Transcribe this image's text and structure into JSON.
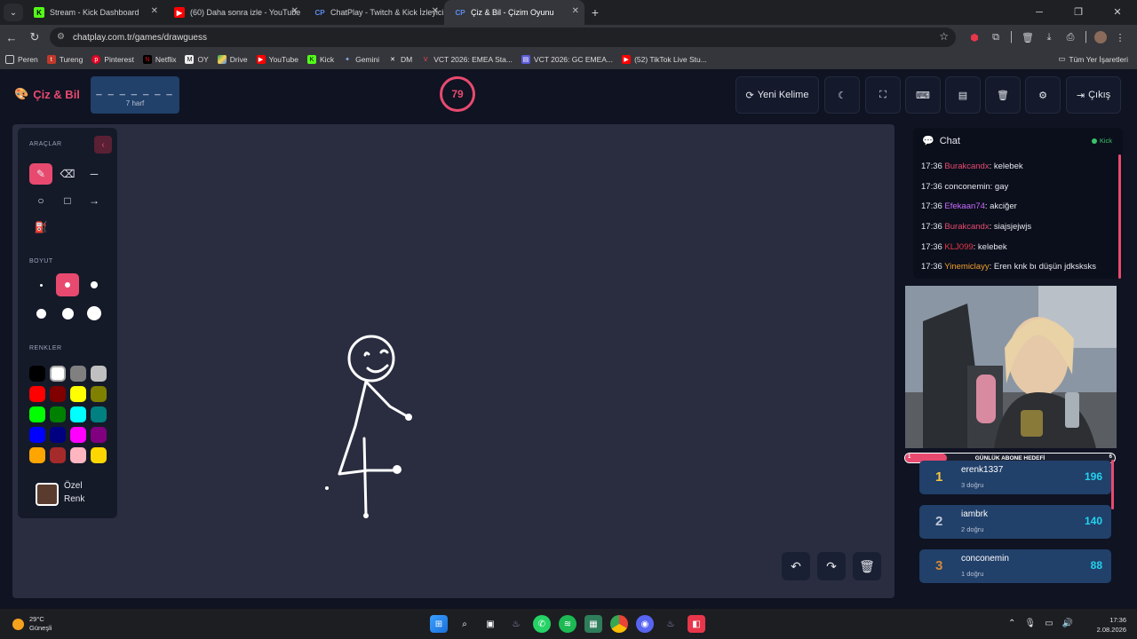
{
  "browser": {
    "tabs": [
      {
        "title": "Stream - Kick Dashboard",
        "favicon": "K",
        "color": "#53fc18"
      },
      {
        "title": "(60) Daha sonra izle - YouTube",
        "favicon": "▶",
        "color": "#ff0000"
      },
      {
        "title": "ChatPlay - Twitch & Kick İzleyici",
        "favicon": "CP",
        "color": "#5b8def"
      },
      {
        "title": "Çiz & Bil - Çizim Oyunu",
        "favicon": "CP",
        "color": "#5b8def"
      }
    ],
    "url": "chatplay.com.tr/games/drawguess",
    "bookmarks": [
      "Peren",
      "Tureng",
      "Pinterest",
      "Netflix",
      "OY",
      "Drive",
      "YouTube",
      "Kick",
      "Gemini",
      "DM",
      "VCT 2026: EMEA Sta...",
      "VCT 2026: GC EMEA...",
      "(52) TikTok Live Stu..."
    ],
    "all_bookmarks": "Tüm Yer İşaretleri"
  },
  "game": {
    "logo": "Çiz & Bil",
    "word_mask": "_ _ _ _ _ _ _",
    "word_length": "7 harf",
    "timer": "79",
    "timer_progress": 0.9,
    "buttons": {
      "new_word": "Yeni Kelime",
      "exit": "Çıkış"
    }
  },
  "tools": {
    "tools_title": "ARAÇLAR",
    "size_title": "BOYUT",
    "colors_title": "RENKLER",
    "custom_color_label": "Özel Renk",
    "selected_tool": "pencil",
    "selected_size": 2,
    "custom_color": "#5a3c2e",
    "palette": [
      "#000000",
      "#ffffff",
      "#808080",
      "#c0c0c0",
      "#ff0000",
      "#800000",
      "#ffff00",
      "#808000",
      "#00ff00",
      "#008000",
      "#00ffff",
      "#008080",
      "#0000ff",
      "#000080",
      "#ff00ff",
      "#800080",
      "#ffa500",
      "#a52a2a",
      "#ffb6c1",
      "#ffd700"
    ]
  },
  "chat": {
    "title": "Chat",
    "source": "Kick",
    "messages": [
      {
        "time": "17:36",
        "user": "Burakcandx",
        "color": "#e84a6f",
        "text": "kelebek"
      },
      {
        "time": "17:36",
        "user": "conconemin",
        "color": "#e6e8ef",
        "text": "gay"
      },
      {
        "time": "17:36",
        "user": "Efekaan74",
        "color": "#c86bff",
        "text": "akciğer"
      },
      {
        "time": "17:36",
        "user": "Burakcandx",
        "color": "#e84a6f",
        "text": "siajsjejwjs"
      },
      {
        "time": "17:36",
        "user": "KLJ099",
        "color": "#e8364a",
        "text": "kelebek"
      },
      {
        "time": "17:36",
        "user": "Yinemiclayy",
        "color": "#f0a030",
        "text": "Eren knk bı düşün jdksksks"
      }
    ]
  },
  "goal": {
    "label": "GÜNLÜK ABONE HEDEFİ",
    "current": "1",
    "target": "6",
    "progress": 0.2
  },
  "leaderboard": [
    {
      "rank": "1",
      "name": "erenk1337",
      "correct": "3 doğru",
      "score": "196",
      "rank_color": "#f4c542"
    },
    {
      "rank": "2",
      "name": "iambrk",
      "correct": "2 doğru",
      "score": "140",
      "rank_color": "#c0c7d6"
    },
    {
      "rank": "3",
      "name": "conconemin",
      "correct": "1 doğru",
      "score": "88",
      "rank_color": "#d4893a"
    }
  ],
  "taskbar": {
    "temp": "29°C",
    "weather": "Güneşli",
    "time": "17:36",
    "date": "2.08.2026"
  }
}
